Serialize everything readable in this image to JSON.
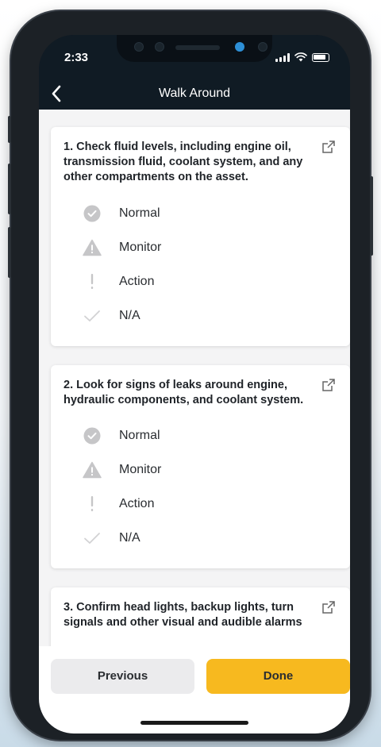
{
  "status_bar": {
    "time": "2:33"
  },
  "header": {
    "back_icon": "chevron-left-icon",
    "title": "Walk Around"
  },
  "checklist": [
    {
      "text": "1. Check fluid levels, including engine oil, transmission fluid, coolant system, and any other compartments on the asset.",
      "options": [
        {
          "label": "Normal",
          "icon": "check-circle-icon"
        },
        {
          "label": "Monitor",
          "icon": "warning-triangle-icon"
        },
        {
          "label": "Action",
          "icon": "exclamation-icon"
        },
        {
          "label": "N/A",
          "icon": "checkmark-icon"
        }
      ]
    },
    {
      "text": "2. Look for signs of leaks around engine, hydraulic components, and coolant system.",
      "options": [
        {
          "label": "Normal",
          "icon": "check-circle-icon"
        },
        {
          "label": "Monitor",
          "icon": "warning-triangle-icon"
        },
        {
          "label": "Action",
          "icon": "exclamation-icon"
        },
        {
          "label": "N/A",
          "icon": "checkmark-icon"
        }
      ]
    },
    {
      "text": "3. Confirm head lights, backup lights, turn signals and other visual and audible alarms",
      "options": []
    }
  ],
  "footer": {
    "previous_label": "Previous",
    "done_label": "Done"
  },
  "colors": {
    "done_button": "#f7b91f",
    "header_bg": "#101b24",
    "option_icon": "#c6c6c8"
  }
}
